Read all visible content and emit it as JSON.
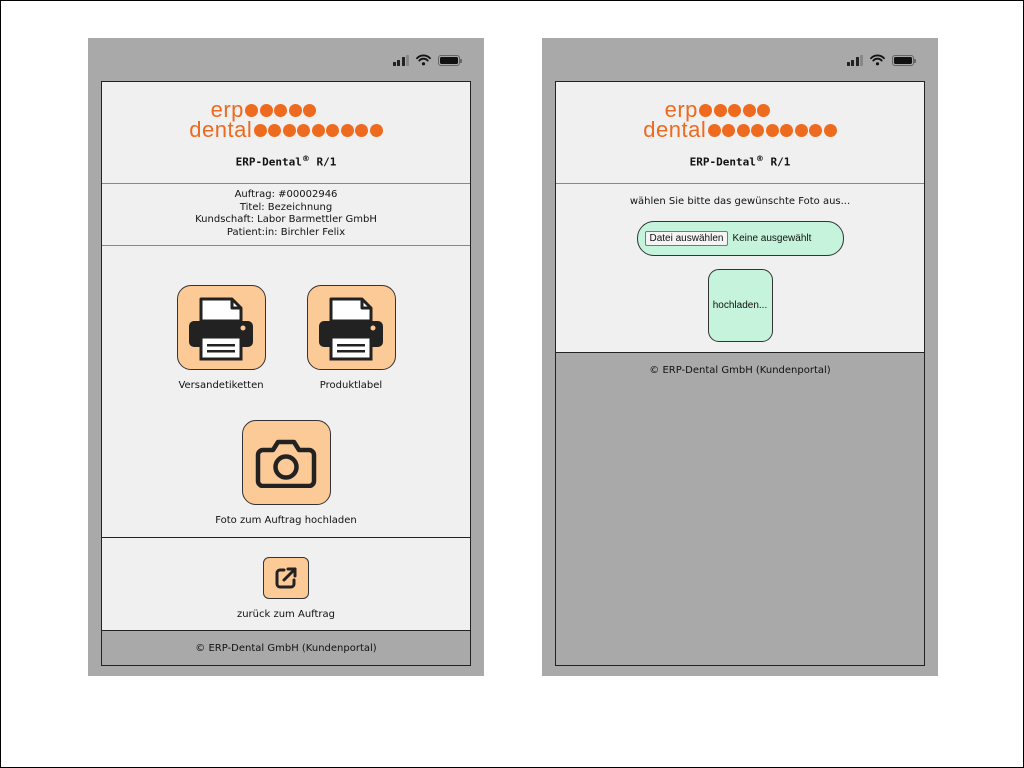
{
  "colors": {
    "brand_orange": "#ee6a1f",
    "tile_fill": "#fcca96",
    "upload_fill": "#c5f3dc",
    "panel_bg": "#f0f0f0",
    "frame_gray": "#a9a9a9"
  },
  "logo": {
    "line1": "erp",
    "line2": "dental"
  },
  "left_screen": {
    "app_title": "ERP-Dental",
    "app_title_mark": "®",
    "app_title_suffix": " R/1",
    "order": {
      "auftrag": "Auftrag: #00002946",
      "titel": "Titel: Bezeichnung",
      "kundschaft": "Kundschaft: Labor Barmettler GmbH",
      "patient": "Patient:in: Birchler Felix"
    },
    "buttons": {
      "versand_label": "Versandetiketten",
      "versand_icon": "printer-icon",
      "produkt_label": "Produktlabel",
      "produkt_icon": "printer-icon",
      "foto_label": "Foto zum Auftrag hochladen",
      "foto_icon": "camera-icon",
      "back_label": "zurück zum Auftrag",
      "back_icon": "external-link-icon"
    },
    "footer": "© ERP-Dental GmbH (Kundenportal)"
  },
  "right_screen": {
    "app_title": "ERP-Dental",
    "app_title_mark": "®",
    "app_title_suffix": " R/1",
    "prompt": "wählen Sie bitte das gewünschte Foto aus...",
    "file_button": "Datei auswählen",
    "file_status": "Keine ausgewählt",
    "upload_button": "hochladen...",
    "footer": "© ERP-Dental GmbH (Kundenportal)"
  }
}
